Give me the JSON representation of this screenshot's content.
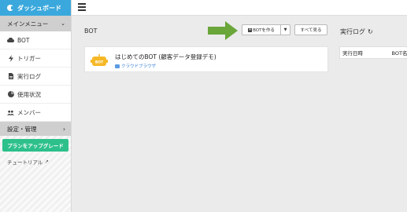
{
  "sidebar": {
    "brand": "ダッシュボード",
    "menu_head": "メインメニュー",
    "items": [
      {
        "label": "BOT",
        "icon": "cloud-icon"
      },
      {
        "label": "トリガー",
        "icon": "bolt-icon"
      },
      {
        "label": "実行ログ",
        "icon": "document-icon"
      },
      {
        "label": "使用状況",
        "icon": "pie-chart-icon"
      },
      {
        "label": "メンバー",
        "icon": "users-icon"
      }
    ],
    "settings": "設定・管理",
    "upgrade": "プランをアップグレード",
    "tutorial": "チュートリアル"
  },
  "main": {
    "bot_title": "BOT",
    "create_button": "BOTを作る",
    "see_all_button": "すべて見る",
    "bot_card": {
      "name": "はじめてのBOT (顧客データ登録デモ)",
      "sub": "クラウドブラウザ",
      "icon_label": "BOT"
    }
  },
  "log": {
    "title": "実行ログ",
    "col_time": "実行日時",
    "col_bot": "BOT名"
  },
  "colors": {
    "brand": "#3aa8dc",
    "upgrade": "#2dc08b",
    "arrow": "#6aa63a",
    "bot_icon": "#f5b826"
  }
}
